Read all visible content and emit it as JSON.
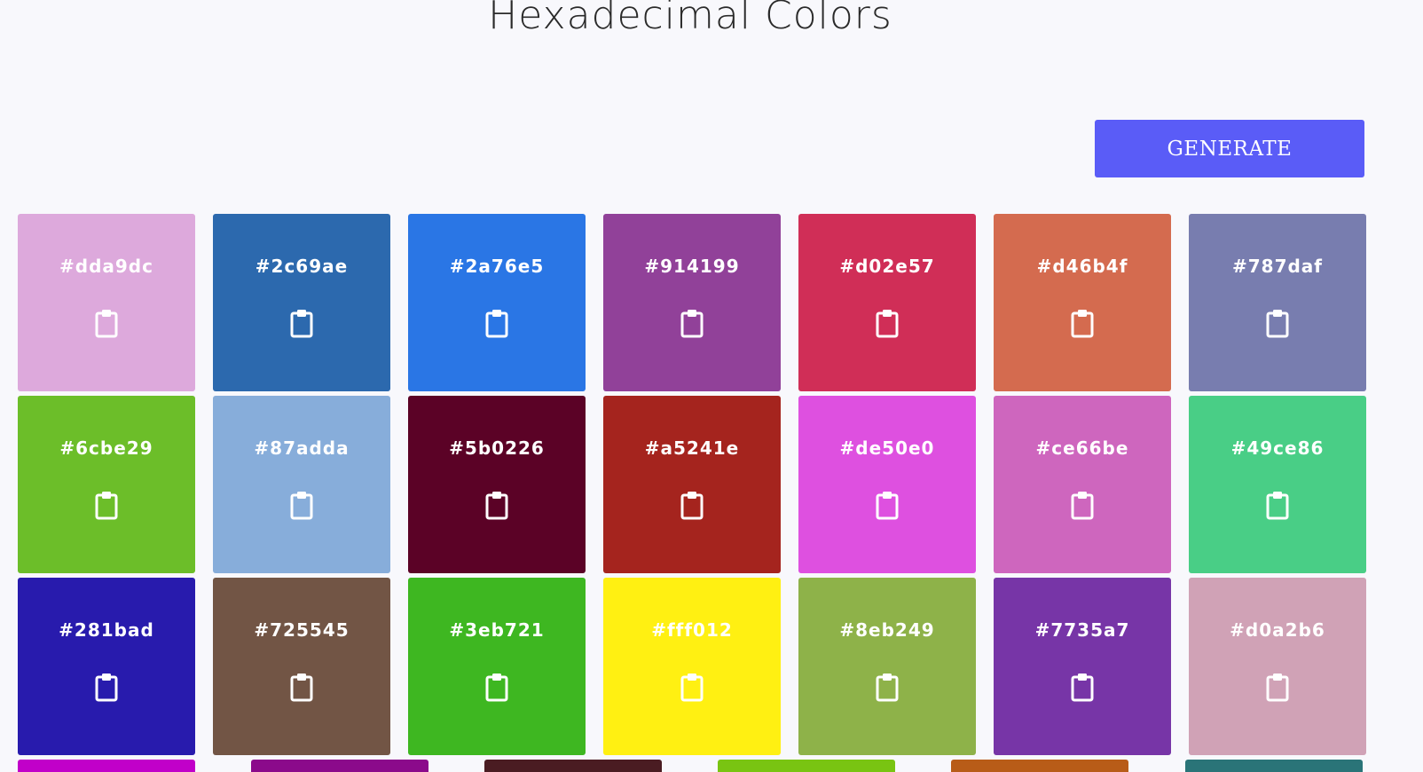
{
  "header": {
    "title": "Hexadecimal Colors"
  },
  "actions": {
    "generate_label": "GENERATE",
    "generate_color": "#5a5cf7"
  },
  "icons": {
    "copy": "clipboard-icon"
  },
  "colors": [
    {
      "hex": "#dda9dc"
    },
    {
      "hex": "#2c69ae"
    },
    {
      "hex": "#2a76e5"
    },
    {
      "hex": "#914199"
    },
    {
      "hex": "#d02e57"
    },
    {
      "hex": "#d46b4f"
    },
    {
      "hex": "#787daf"
    },
    {
      "hex": "#6cbe29"
    },
    {
      "hex": "#87adda"
    },
    {
      "hex": "#5b0226"
    },
    {
      "hex": "#a5241e"
    },
    {
      "hex": "#de50e0"
    },
    {
      "hex": "#ce66be"
    },
    {
      "hex": "#49ce86"
    },
    {
      "hex": "#281bad"
    },
    {
      "hex": "#725545"
    },
    {
      "hex": "#3eb721"
    },
    {
      "hex": "#fff012"
    },
    {
      "hex": "#8eb249"
    },
    {
      "hex": "#7735a7"
    },
    {
      "hex": "#d0a2b6"
    }
  ],
  "partial_row_colors": [
    "#c100c9",
    "#8b0a8b",
    "#4a1c22",
    "#79c412",
    "#b85c18",
    "#2a7478"
  ]
}
